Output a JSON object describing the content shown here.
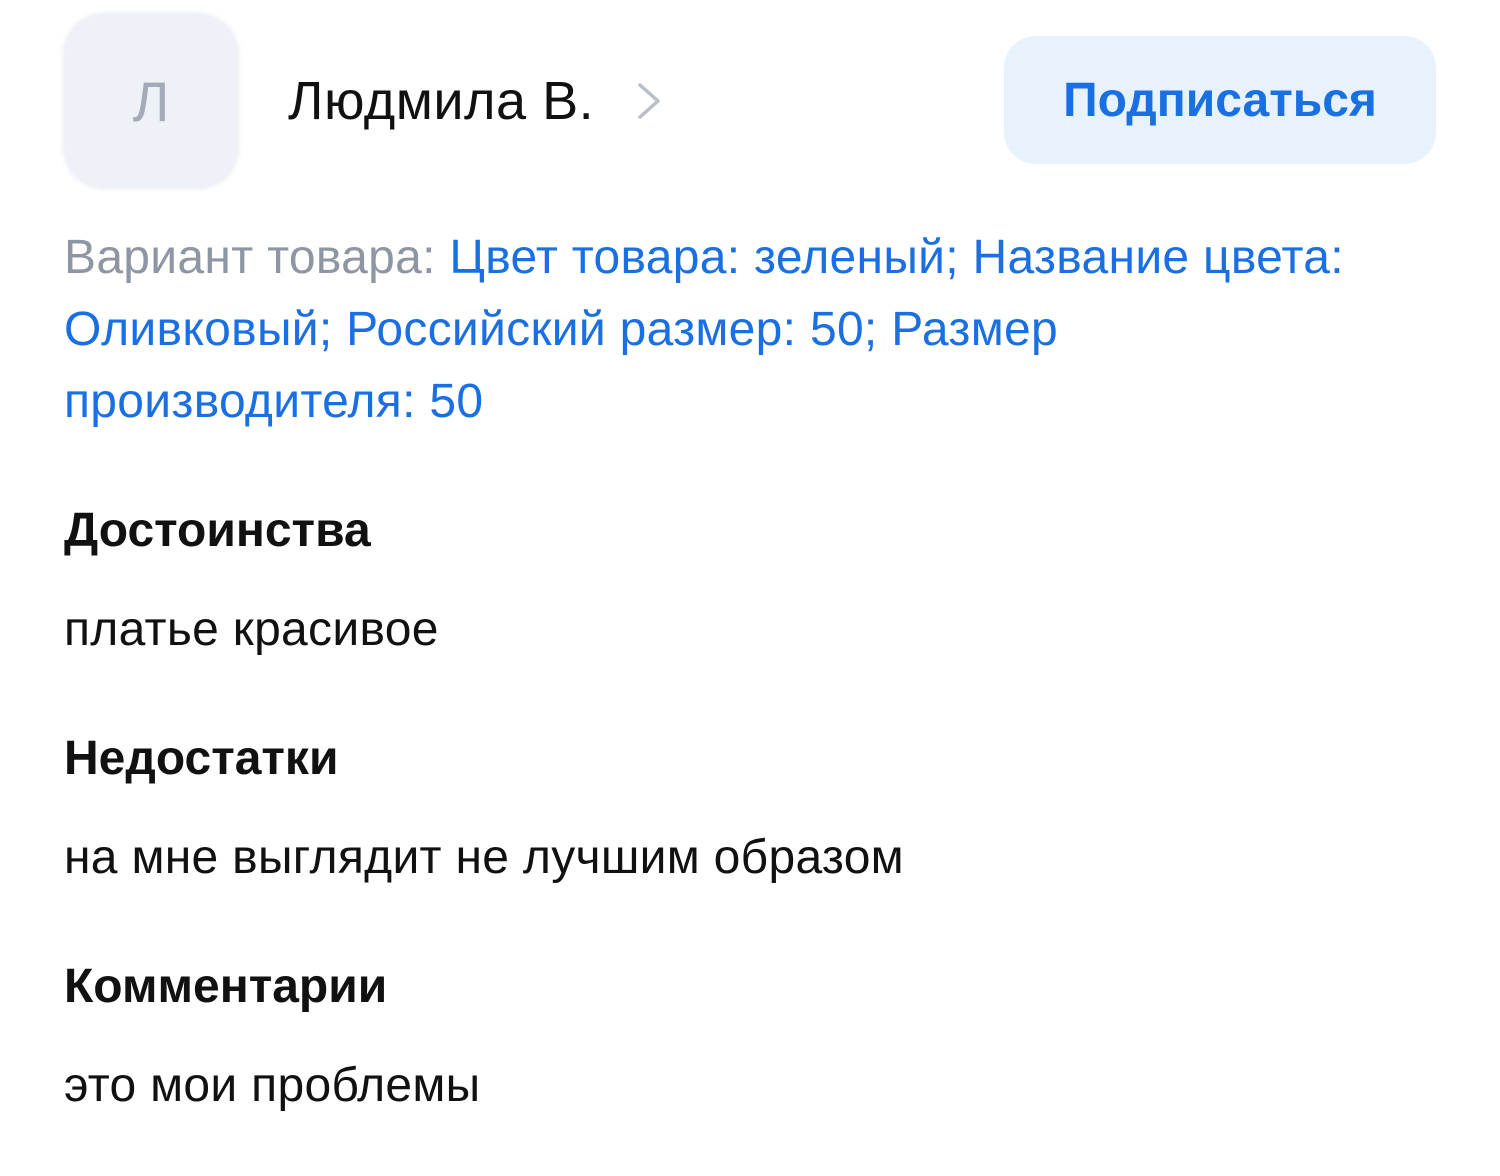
{
  "review": {
    "author": {
      "initial": "Л",
      "name": "Людмила В.",
      "chevron_icon": "chevron-right-icon"
    },
    "subscribe_button": {
      "label": "Подписаться"
    },
    "variant": {
      "label": "Вариант товара: ",
      "value": "Цвет товара: зеленый; Название цвета: Оливковый; Российский размер: 50; Размер производителя: 50"
    },
    "pros": {
      "title": "Достоинства",
      "text": "платье красивое"
    },
    "cons": {
      "title": "Недостатки",
      "text": "на мне выглядит не лучшим образом"
    },
    "comments": {
      "title": "Комментарии",
      "text": "это мои проблемы"
    }
  },
  "colors": {
    "accent": "#1a6fe3",
    "button_bg": "#e8f2fd",
    "muted_text": "#8f96a3",
    "avatar_bg": "#eef1f7",
    "avatar_text": "#a3abb8",
    "primary_text": "#111111"
  }
}
